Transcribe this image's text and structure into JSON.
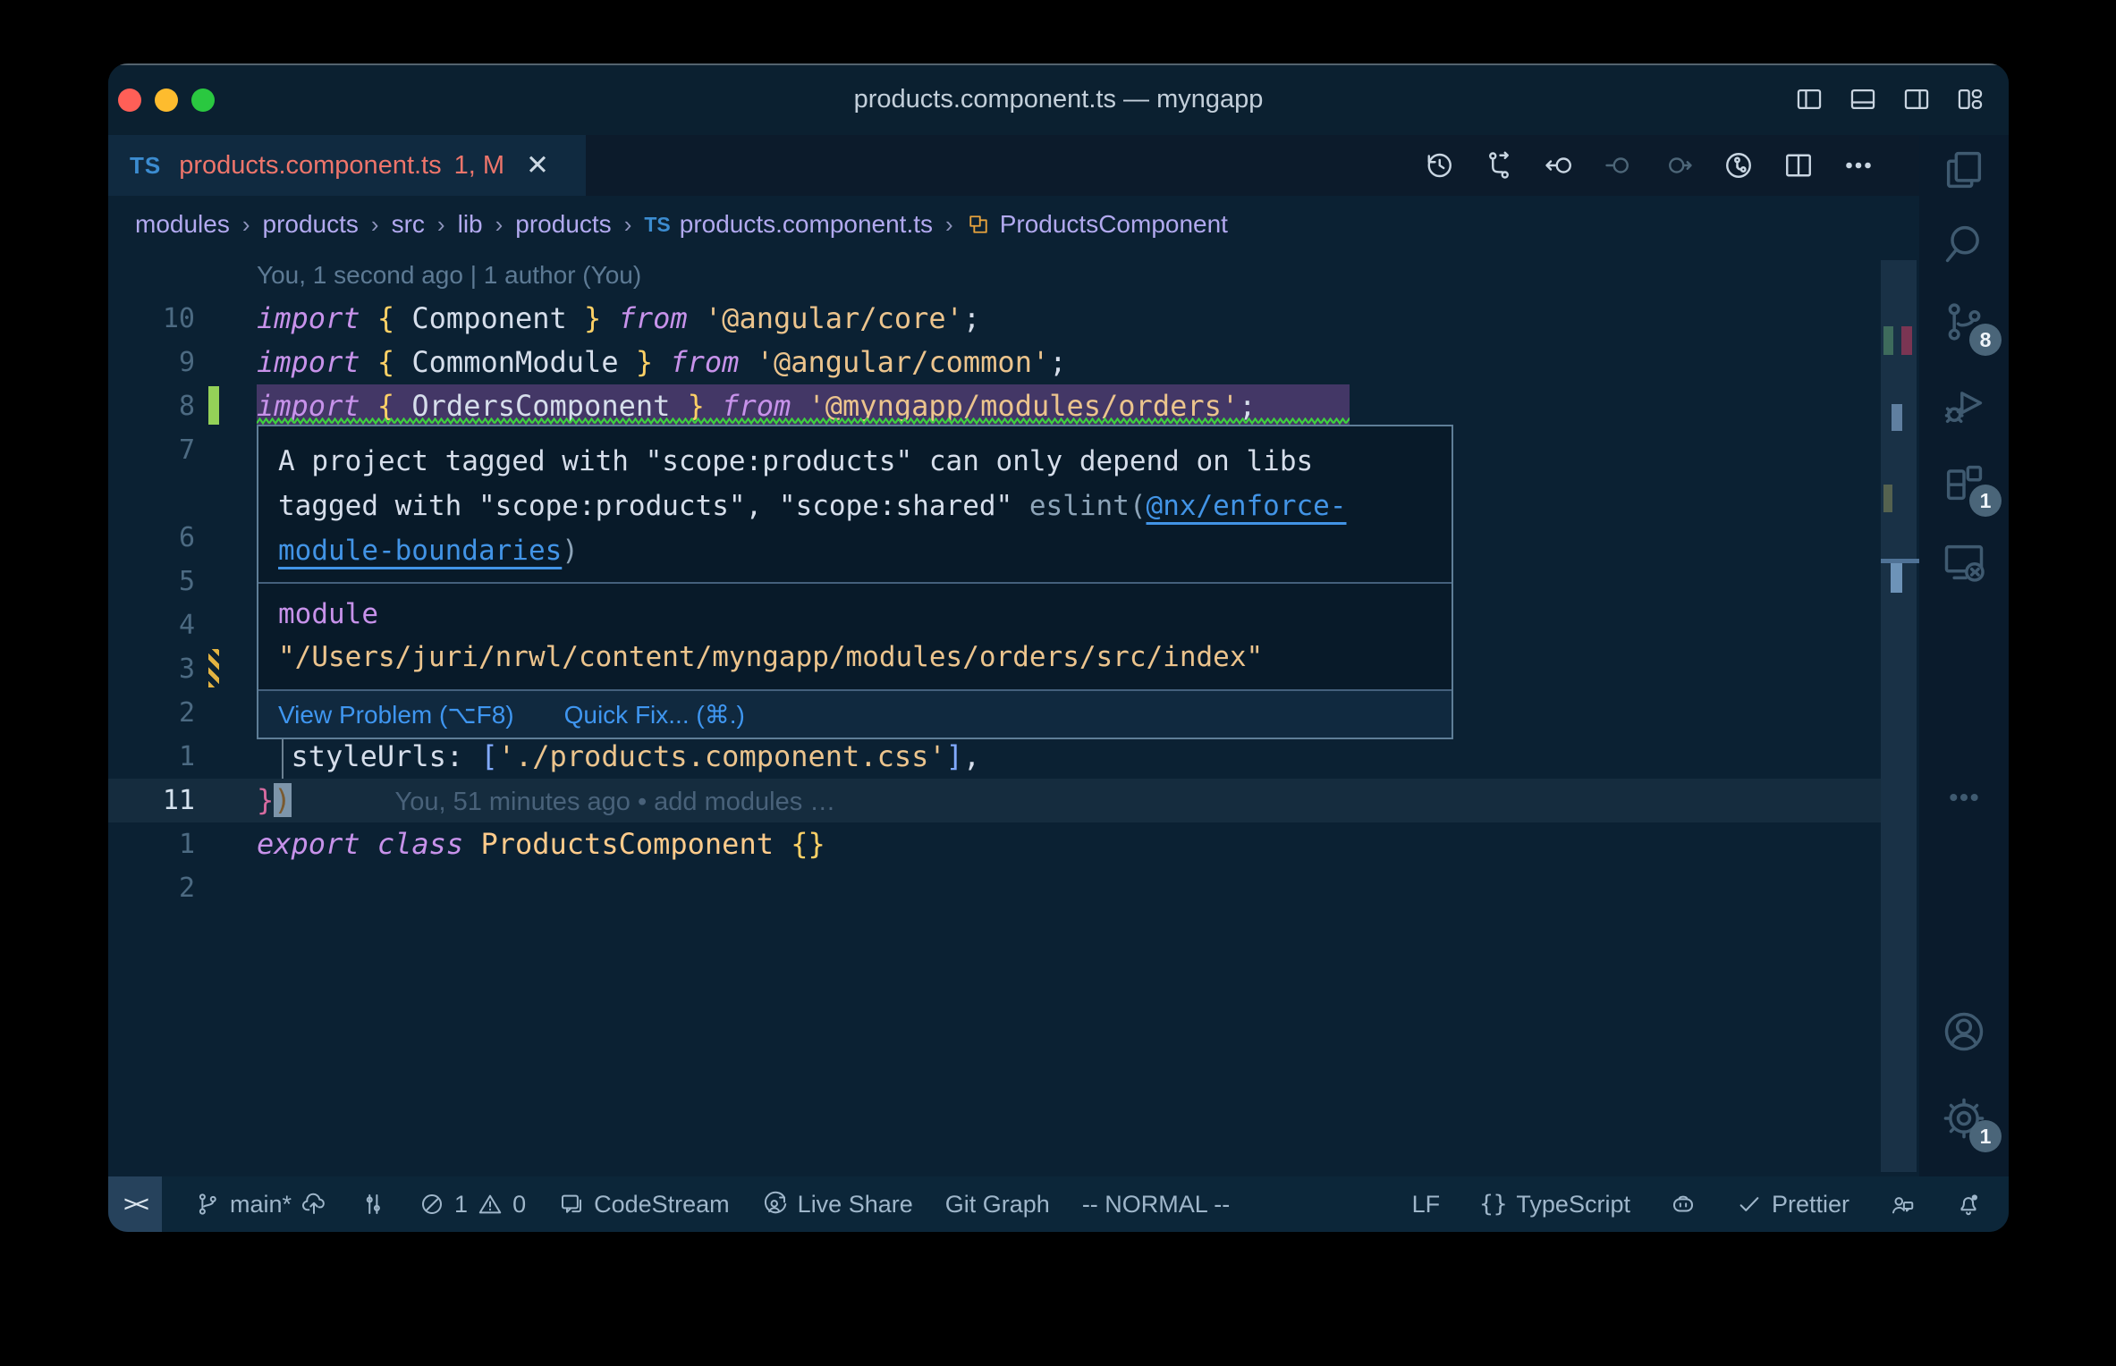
{
  "window": {
    "title": "products.component.ts — myngapp",
    "traffic_lights": [
      "close",
      "minimize",
      "zoom"
    ]
  },
  "titlebar": {
    "icons": [
      {
        "name": "layout-sidebar-left"
      },
      {
        "name": "layout-panel"
      },
      {
        "name": "layout-sidebar-right"
      },
      {
        "name": "layout-customize"
      }
    ]
  },
  "tab": {
    "badge": "TS",
    "label": "products.component.ts",
    "dirty": "1, M",
    "close": "✕"
  },
  "editor_toolbar": {
    "icons": [
      {
        "name": "timeline-history"
      },
      {
        "name": "compare-changes"
      },
      {
        "name": "nav-back"
      },
      {
        "name": "previous-change",
        "dim": true
      },
      {
        "name": "next-change",
        "dim": true
      },
      {
        "name": "run-timeline"
      },
      {
        "name": "split-editor"
      },
      {
        "name": "more-actions"
      }
    ]
  },
  "breadcrumbs": {
    "separator": "›",
    "items": [
      {
        "label": "modules"
      },
      {
        "label": "products"
      },
      {
        "label": "src"
      },
      {
        "label": "lib"
      },
      {
        "label": "products"
      },
      {
        "icon": "ts-badge",
        "label": "products.component.ts"
      },
      {
        "icon": "symbol-class",
        "label": "ProductsComponent"
      }
    ]
  },
  "editor": {
    "lines": [
      {
        "num": "",
        "ann": "You, 1 second ago | 1 author (You)"
      },
      {
        "num": "10",
        "tokens": [
          {
            "t": "kw",
            "v": "import"
          },
          {
            "t": "pl",
            "v": " "
          },
          {
            "t": "br",
            "v": "{"
          },
          {
            "t": "pl",
            "v": " "
          },
          {
            "t": "id",
            "v": "Component"
          },
          {
            "t": "pl",
            "v": " "
          },
          {
            "t": "br",
            "v": "}"
          },
          {
            "t": "pl",
            "v": " "
          },
          {
            "t": "kw",
            "v": "from"
          },
          {
            "t": "pl",
            "v": " "
          },
          {
            "t": "str",
            "v": "'@angular/core'"
          },
          {
            "t": "pl",
            "v": ";"
          }
        ]
      },
      {
        "num": "9",
        "tokens": [
          {
            "t": "kw",
            "v": "import"
          },
          {
            "t": "pl",
            "v": " "
          },
          {
            "t": "br",
            "v": "{"
          },
          {
            "t": "pl",
            "v": " "
          },
          {
            "t": "id",
            "v": "CommonModule"
          },
          {
            "t": "pl",
            "v": " "
          },
          {
            "t": "br",
            "v": "}"
          },
          {
            "t": "pl",
            "v": " "
          },
          {
            "t": "kw",
            "v": "from"
          },
          {
            "t": "pl",
            "v": " "
          },
          {
            "t": "str",
            "v": "'@angular/common'"
          },
          {
            "t": "pl",
            "v": ";"
          }
        ]
      },
      {
        "num": "8",
        "sel": true,
        "marker": "added",
        "tokens": [
          {
            "t": "kw",
            "v": "import"
          },
          {
            "t": "pl",
            "v": " "
          },
          {
            "t": "br",
            "v": "{"
          },
          {
            "t": "pl",
            "v": " "
          },
          {
            "t": "id",
            "v": "OrdersComponent"
          },
          {
            "t": "pl",
            "v": " "
          },
          {
            "t": "br",
            "v": "}"
          },
          {
            "t": "pl",
            "v": " "
          },
          {
            "t": "kw",
            "v": "from"
          },
          {
            "t": "pl",
            "v": " "
          },
          {
            "t": "str",
            "v": "'@myngapp/modules/orders'"
          },
          {
            "t": "pl",
            "v": ";"
          }
        ]
      },
      {
        "num": "7",
        "tokens": []
      },
      {
        "num": "",
        "tokens": []
      },
      {
        "num": "6",
        "tokens": []
      },
      {
        "num": "5",
        "tokens": []
      },
      {
        "num": "4",
        "tokens": []
      },
      {
        "num": "3",
        "marker": "modified",
        "tokens": []
      },
      {
        "num": "2",
        "tokens": []
      },
      {
        "num": "1",
        "tokens": [
          {
            "t": "pl",
            "v": "  "
          },
          {
            "t": "id",
            "v": "styleUrls"
          },
          {
            "t": "pl",
            "v": ": "
          },
          {
            "t": "bkt",
            "v": "["
          },
          {
            "t": "str",
            "v": "'./products.component.css'"
          },
          {
            "t": "bkt",
            "v": "]"
          },
          {
            "t": "pl",
            "v": ","
          }
        ]
      },
      {
        "num": "11",
        "current": true,
        "ghost": "You, 51 minutes ago • add modules …",
        "tokens": [
          {
            "t": "pk",
            "v": "}"
          },
          {
            "t": "cur",
            "v": ")"
          }
        ]
      },
      {
        "num": "1",
        "tokens": [
          {
            "t": "kw",
            "v": "export"
          },
          {
            "t": "pl",
            "v": " "
          },
          {
            "t": "kw",
            "v": "class"
          },
          {
            "t": "pl",
            "v": " "
          },
          {
            "t": "cls",
            "v": "ProductsComponent"
          },
          {
            "t": "pl",
            "v": " "
          },
          {
            "t": "br",
            "v": "{}"
          }
        ]
      },
      {
        "num": "2",
        "tokens": []
      }
    ]
  },
  "hover": {
    "message_lines": [
      [
        {
          "s": "plain",
          "v": "A project tagged with \"scope:products\" can only depend on libs"
        }
      ],
      [
        {
          "s": "plain",
          "v": "tagged with \"scope:products\", \"scope:shared\" "
        },
        {
          "s": "dim",
          "v": "eslint("
        },
        {
          "s": "link",
          "v": "@nx/enforce-"
        }
      ],
      [
        {
          "s": "link",
          "v": "module-boundaries"
        },
        {
          "s": "dim",
          "v": ")"
        }
      ]
    ],
    "module_label": "module",
    "module_path": "\"/Users/juri/nrwl/content/myngapp/modules/orders/src/index\"",
    "actions": [
      "View Problem (⌥F8)",
      "Quick Fix... (⌘.)"
    ]
  },
  "activity_bar": {
    "items": [
      {
        "name": "explorer",
        "icon": "files"
      },
      {
        "name": "search",
        "icon": "search"
      },
      {
        "name": "source-control",
        "icon": "source-control",
        "badge": "8"
      },
      {
        "name": "run-debug",
        "icon": "debug"
      },
      {
        "name": "extensions",
        "icon": "extensions",
        "badge": "1"
      },
      {
        "name": "remote-explorer",
        "icon": "remote-explorer"
      },
      {
        "name": "more-views",
        "icon": "more"
      },
      {
        "name": "account",
        "icon": "account"
      },
      {
        "name": "settings",
        "icon": "gear",
        "badge": "1"
      }
    ]
  },
  "status_bar": {
    "remote_indicator": "><",
    "left": [
      {
        "name": "git-branch",
        "icon": "git-branch",
        "label": "main*",
        "icon2": "cloud-upload"
      },
      {
        "name": "git-compare",
        "icon": "sliders"
      },
      {
        "name": "problems",
        "icon": "error-circle",
        "label": "1",
        "icon2": "warning-triangle",
        "label2": "0"
      },
      {
        "name": "codestream",
        "icon": "codestream",
        "label": "CodeStream"
      },
      {
        "name": "live-share",
        "icon": "live-share",
        "label": "Live Share"
      },
      {
        "name": "git-graph",
        "label": "Git Graph"
      },
      {
        "name": "vim-mode",
        "label": "-- NORMAL --"
      }
    ],
    "right": [
      {
        "name": "eol",
        "label": "LF"
      },
      {
        "name": "language",
        "icon": "braces",
        "label": "TypeScript"
      },
      {
        "name": "copilot",
        "icon": "copilot"
      },
      {
        "name": "prettier",
        "icon": "check",
        "label": "Prettier"
      },
      {
        "name": "feedback",
        "icon": "feedback"
      },
      {
        "name": "notifications",
        "icon": "bell"
      }
    ]
  },
  "colors": {
    "editor_bg": "#0b2133",
    "tab_modified": "#ee756b",
    "ts_blue": "#3c8cd0",
    "breadcrumb": "#b2a9ef",
    "error_squiggle": "#3ed13e",
    "added_gutter": "#94d158",
    "modified_gutter": "#e3b341",
    "link_blue": "#4294e6",
    "selection_bg": "#433766"
  }
}
